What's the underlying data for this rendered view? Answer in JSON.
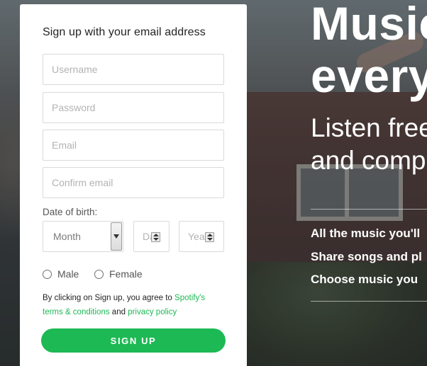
{
  "signup_form": {
    "title": "Sign up with your email address",
    "username_placeholder": "Username",
    "password_placeholder": "Password",
    "email_placeholder": "Email",
    "confirm_email_placeholder": "Confirm email",
    "dob_label": "Date of birth:",
    "month_selected": "Month",
    "day_placeholder": "Day",
    "year_placeholder": "Year",
    "gender_options": [
      "Male",
      "Female"
    ],
    "terms_prefix": "By clicking on Sign up, you agree to ",
    "terms_link": "Spotify's terms & conditions",
    "terms_and": " and ",
    "privacy_link": "privacy policy",
    "signup_button": "SIGN UP"
  },
  "hero": {
    "headline_lines": [
      "Music for",
      "everyone."
    ],
    "subheadline_lines": [
      "Listen free",
      "and comp"
    ],
    "bullets": [
      "All the music you'll",
      "Share songs and pl",
      "Choose music you"
    ]
  },
  "colors": {
    "brand_green": "#1db954",
    "card_bg": "#ffffff"
  }
}
